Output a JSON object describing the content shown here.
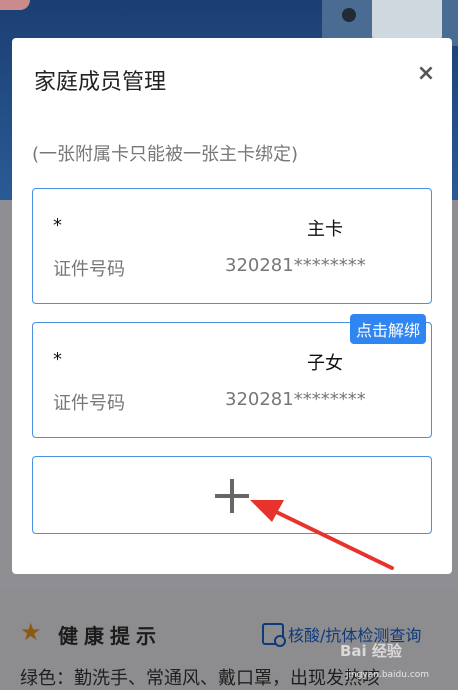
{
  "modal": {
    "title": "家庭成员管理",
    "close_label": "×",
    "note": "(一张附属卡只能被一张主卡绑定)",
    "members": [
      {
        "name": "*",
        "role": "主卡",
        "id_label": "证件号码",
        "id_value": "320281********"
      },
      {
        "name": "*",
        "role": "子女",
        "id_label": "证件号码",
        "id_value": "320281********"
      }
    ],
    "unbind_label": "点击解绑",
    "add_icon": "plus-icon"
  },
  "background": {
    "health_title": "健康提示",
    "query_label": "核酸/抗体检测查询",
    "tips": "绿色：勤洗手、常通风、戴口罩，出现发热咳",
    "watermark": "Bai 经验",
    "watermark_url": "jingyan.baidu.com"
  },
  "colors": {
    "accent": "#2f86f2",
    "card_border": "#4a8fe0",
    "annotation_arrow": "#e8332c"
  }
}
